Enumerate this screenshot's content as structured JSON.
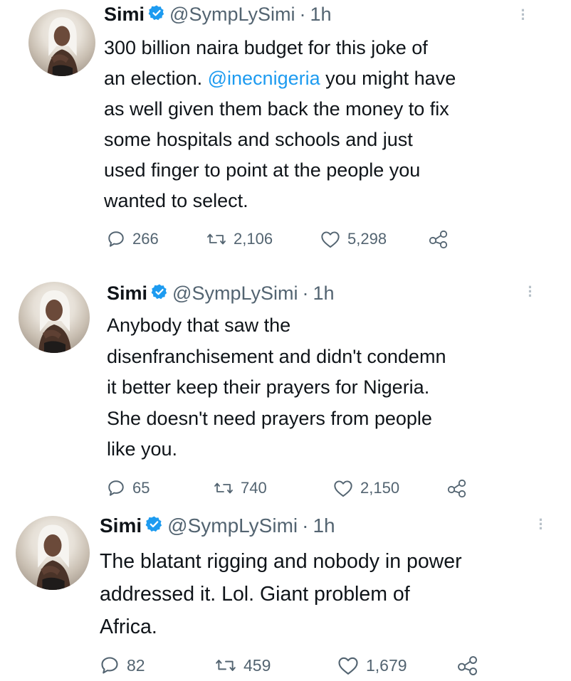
{
  "tweets": [
    {
      "name": "Simi",
      "handle": "@SympLySimi",
      "separator": "·",
      "time": "1h",
      "text_before_mention": "300 billion naira budget for this joke of\nan election. ",
      "mention": "@inecnigeria",
      "text_after_mention": " you might have\nas well given them back the money to fix\nsome hospitals and schools and just\nused finger to point at the people you\nwanted to select.",
      "replies": "266",
      "retweets": "2,106",
      "likes": "5,298"
    },
    {
      "name": "Simi",
      "handle": "@SympLySimi",
      "separator": "·",
      "time": "1h",
      "text": "Anybody that saw the\ndisenfranchisement and didn't condemn\nit better keep their prayers for Nigeria.\nShe doesn't need prayers from people\nlike you.",
      "replies": "65",
      "retweets": "740",
      "likes": "2,150"
    },
    {
      "name": "Simi",
      "handle": "@SympLySimi",
      "separator": "·",
      "time": "1h",
      "text": "The blatant rigging and nobody in power\naddressed it. Lol. Giant problem of\nAfrica.",
      "replies": "82",
      "retweets": "459",
      "likes": "1,679"
    }
  ],
  "icons": {
    "reply": "reply-icon",
    "retweet": "retweet-icon",
    "like": "heart-icon",
    "share": "share-icon",
    "verified": "verified-badge-icon",
    "more": "more-options-icon"
  },
  "colors": {
    "text": "#0f1419",
    "secondary": "#536471",
    "mention": "#1d9bf0",
    "verified": "#1d9bf0"
  }
}
